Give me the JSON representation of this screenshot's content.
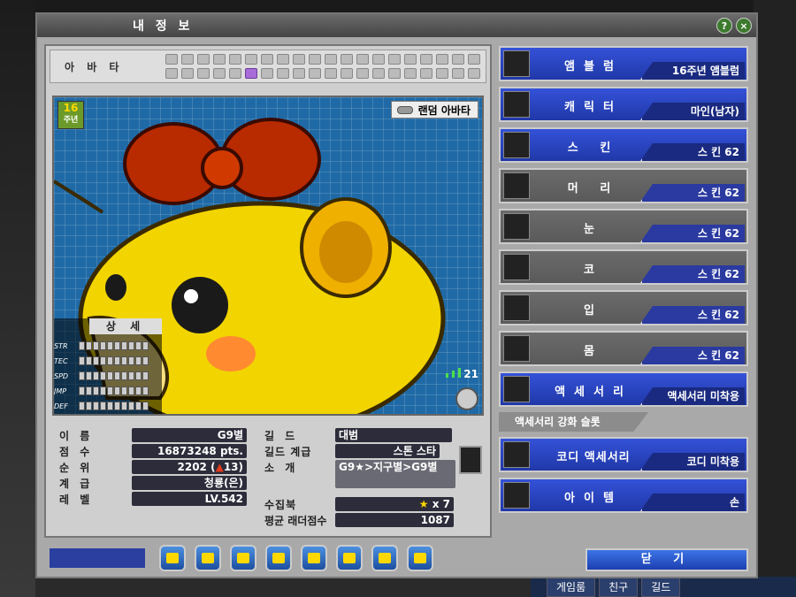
{
  "window": {
    "title": "내 정 보"
  },
  "avatar_bar": {
    "label": "아 바 타",
    "active_slot_index": 25
  },
  "viewer": {
    "random_avatar_label": "랜덤 아바타",
    "badge_num": "16",
    "badge_text": "주년",
    "signal_value": "21",
    "detail_title": "상 세",
    "stats": [
      "STR",
      "TEC",
      "SPD",
      "JMP",
      "DEF"
    ]
  },
  "info": {
    "name_label": "이 름",
    "name": "G9별",
    "score_label": "점 수",
    "score": "16873248 pts.",
    "rank_label": "순 위",
    "rank": "2202",
    "rank_up": "13",
    "grade_label": "계 급",
    "grade": "청룡(은)",
    "level_label": "레 벨",
    "level": "LV.542",
    "guild_label": "길 드",
    "guild": "대범",
    "guild_rank_label": "길드 계급",
    "guild_rank": "스톤 스타",
    "intro_label": "소 개",
    "intro": "G9★>지구별>G9별",
    "collection_label": "수집북",
    "collection": "x 7",
    "ladder_label": "평균 래더점수",
    "ladder": "1087"
  },
  "right_rows": [
    {
      "label": "앰블럼",
      "value": "16주년 앰블럼",
      "color": "blue"
    },
    {
      "label": "캐릭터",
      "value": "마인(남자)",
      "color": "blue"
    },
    {
      "label": "스 킨",
      "value": "스 킨 62",
      "color": "blue"
    },
    {
      "label": "머 리",
      "value": "스 킨 62",
      "color": "gray"
    },
    {
      "label": "눈",
      "value": "스 킨 62",
      "color": "gray"
    },
    {
      "label": "코",
      "value": "스 킨 62",
      "color": "gray"
    },
    {
      "label": "입",
      "value": "스 킨 62",
      "color": "gray"
    },
    {
      "label": "몸",
      "value": "스 킨 62",
      "color": "gray"
    },
    {
      "label": "액세서리",
      "value": "액세서리 미착용",
      "color": "blue"
    },
    {
      "label": "코디 액세서리",
      "value": "코디 미착용",
      "color": "blue"
    },
    {
      "label": "아이템",
      "value": "손",
      "color": "blue"
    }
  ],
  "accessory_slot_strip": "액세서리 강화 슬롯",
  "close_button": "닫 기",
  "bg_tabs": [
    "게임룸",
    "친구",
    "길드"
  ]
}
